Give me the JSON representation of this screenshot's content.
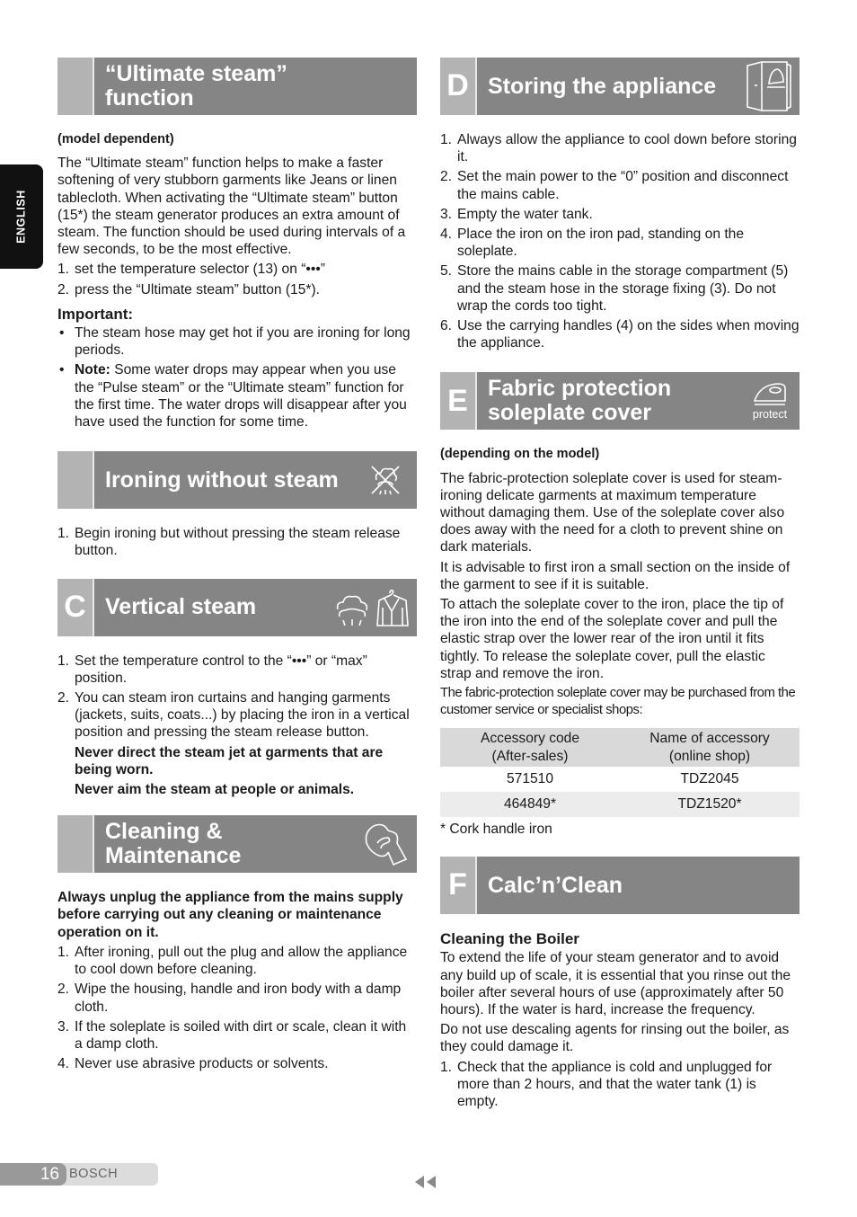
{
  "side_tab": {
    "label": "ENGLISH"
  },
  "left": {
    "ultimate": {
      "letter": "",
      "title_line1": "“Ultimate steam”",
      "title_line2": "function",
      "subhead": "(model dependent)",
      "intro": "The “Ultimate steam” function helps to make a faster softening of very stubborn garments like Jeans or linen tablecloth. When activating the “Ultimate steam” button (15*) the steam generator produces an extra amount of steam. The function should be used during intervals of a few seconds, to be the most effective.",
      "steps": [
        {
          "n": "1.",
          "t": "set the temperature selector (13) on “•••”"
        },
        {
          "n": "2.",
          "t": "press the “Ultimate steam” button (15*)."
        }
      ],
      "important_label": "Important:",
      "bullets": [
        {
          "b": "•",
          "t": "The steam hose may get hot if you are ironing for long periods."
        }
      ],
      "note_label": "Note:",
      "note_text": " Some water drops may appear when you use the “Pulse steam” or the “Ultimate steam” function for the first time. The water drops will disappear after you have used the function for some time."
    },
    "without_steam": {
      "letter": "",
      "title": "Ironing without steam",
      "icon": "no-steam-icon",
      "steps": [
        {
          "n": "1.",
          "t": "Begin ironing but without pressing the steam release button."
        }
      ]
    },
    "vertical": {
      "letter": "C",
      "title": "Vertical steam",
      "icon": "vertical-steam-garment-icon",
      "steps": [
        {
          "n": "1.",
          "t": "Set the temperature control to the “•••” or “max” position."
        },
        {
          "n": "2.",
          "t": "You can steam iron curtains and hanging garments (jackets, suits, coats...) by placing the iron in a vertical position and pressing the steam release button."
        }
      ],
      "warning1": "Never direct the steam jet at garments that are being worn.",
      "warning2": "Never aim the steam at people or animals."
    },
    "cleaning": {
      "letter": "",
      "title_line1": "Cleaning &",
      "title_line2": "Maintenance",
      "icon": "wiping-cloth-icon",
      "warning": "Always unplug the appliance from the mains supply before carrying out any cleaning or maintenance operation on it.",
      "steps": [
        {
          "n": "1.",
          "t": "After ironing, pull out the plug and allow the appliance to cool down before cleaning."
        },
        {
          "n": "2.",
          "t": "Wipe the housing, handle and iron body with a damp cloth."
        },
        {
          "n": "3.",
          "t": " If the soleplate is soiled with dirt or scale, clean it with a damp cloth."
        },
        {
          "n": "4.",
          "t": "Never use abrasive products or solvents."
        }
      ]
    }
  },
  "right": {
    "storing": {
      "letter": "D",
      "title": "Storing the appliance",
      "icon": "storage-cabinet-icon",
      "steps": [
        {
          "n": "1.",
          "t": "Always allow the appliance to cool down before storing it."
        },
        {
          "n": "2.",
          "t": "Set the main power to the “0” position and disconnect the mains cable."
        },
        {
          "n": "3.",
          "t": "Empty the water tank."
        },
        {
          "n": "4.",
          "t": "Place the iron on the iron pad, standing on the soleplate."
        },
        {
          "n": "5.",
          "t": "Store the mains cable in the storage compartment (5) and the steam hose in the storage fixing (3). Do not wrap the cords too tight."
        },
        {
          "n": "6.",
          "t": "Use the carrying handles (4) on the sides when moving the appliance."
        }
      ]
    },
    "fabric": {
      "letter": "E",
      "title_line1": "Fabric protection",
      "title_line2": "soleplate cover",
      "icon": "iron-protect-icon",
      "icon_label": "protect",
      "subhead": "(depending on the model)",
      "para1": "The fabric-protection soleplate cover is used for steam-ironing delicate garments at maximum temperature without damaging them. Use of the soleplate cover also does away with the need for a cloth to prevent shine on dark materials.",
      "para2": "It is advisable to first iron a small section on the inside of the garment to see if it is suitable.",
      "para3": "To attach the soleplate cover to the iron, place the tip of the iron into the end of the soleplate cover and pull the elastic strap over the lower rear of the iron until it fits tightly. To release the soleplate cover, pull the elastic strap and remove the iron.",
      "para4": "The fabric-protection soleplate cover may be purchased from the customer service or specialist shops:",
      "table": {
        "headers": [
          {
            "line1": "Accessory code",
            "line2": "(After-sales)"
          },
          {
            "line1": "Name of accessory",
            "line2": "(online shop)"
          }
        ],
        "rows": [
          [
            "571510",
            "TDZ2045"
          ],
          [
            "464849*",
            "TDZ1520*"
          ]
        ]
      },
      "footnote": "* Cork handle iron"
    },
    "calc": {
      "letter": "F",
      "title": "Calc’n’Clean",
      "subhead": "Cleaning the Boiler",
      "para1": "To extend the life of your steam generator and to avoid any build up of scale, it is essential that you rinse out the boiler after several hours of use (approximately after 50 hours). If the water is hard, increase the frequency.",
      "para2": "Do not use descaling agents for rinsing out the boiler, as they could damage it.",
      "steps": [
        {
          "n": "1.",
          "t": "Check that the appliance is cold and unplugged for more than 2 hours, and that the water tank (1) is empty."
        }
      ]
    }
  },
  "footer": {
    "page_number": "16",
    "brand": "BOSCH",
    "nav_icon": "previous-page-arrows-icon"
  }
}
